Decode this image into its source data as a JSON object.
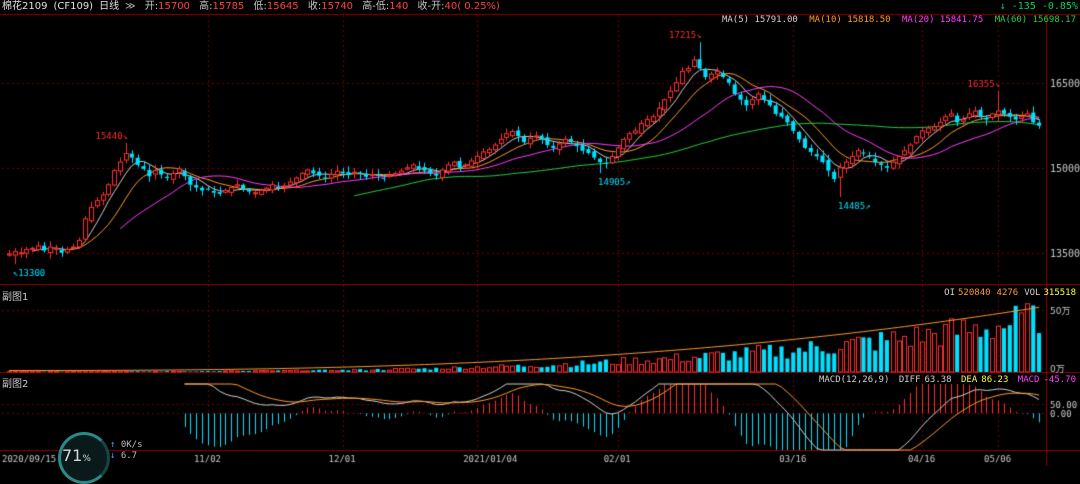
{
  "header": {
    "symbol": "棉花2109",
    "code": "(CF109)",
    "period": "日线",
    "open_label": "开:",
    "open": "15700",
    "high_label": "高:",
    "high": "15785",
    "low_label": "低:",
    "low": "15645",
    "close_label": "收:",
    "close": "15740",
    "hl_label": "高-低:",
    "hl": "140",
    "co_label": "收-开:",
    "co": "40( 0.25%)",
    "change": "↓ -135 -0.85%"
  },
  "ma_legend": [
    {
      "label": "MA(5)",
      "value": "15791.00",
      "color": "#d0d0d0"
    },
    {
      "label": "MA(10)",
      "value": "15818.50",
      "color": "#ff9a2a"
    },
    {
      "label": "MA(20)",
      "value": "15841.75",
      "color": "#ff3cff"
    },
    {
      "label": "MA(60)",
      "value": "15698.17",
      "color": "#20d040"
    }
  ],
  "sub1": {
    "title": "副图1",
    "oi_label": "OI",
    "oi": "520840",
    "change": "4276",
    "vol_label": "VOL",
    "vol": "315518",
    "ticks": [
      "50万",
      "0万"
    ]
  },
  "sub2": {
    "title": "副图2",
    "macd_label": "MACD(12,26,9)",
    "diff_label": "DIFF",
    "diff": "63.38",
    "dea_label": "DEA",
    "dea": "86.23",
    "macd_val_label": "MACD",
    "macd_val": "-45.70",
    "ticks": [
      "50.00",
      "0.00"
    ]
  },
  "gauge": {
    "value": "71",
    "unit": "%",
    "net_down": "0",
    "net_unit": "K/s",
    "net_up": "6.7"
  },
  "colors": {
    "up": "#ff3030",
    "down": "#00e0ff",
    "bg": "#000000",
    "grid": "#8b0000"
  },
  "chart_data": {
    "type": "candlestick",
    "price_ylim": [
      12950,
      17500
    ],
    "price_ticks": [
      13500,
      15000,
      16500
    ],
    "x_labels": [
      {
        "i": 0,
        "label": "2020/09/15"
      },
      {
        "i": 34,
        "label": "11/02"
      },
      {
        "i": 57,
        "label": "12/01"
      },
      {
        "i": 80,
        "label": "2021/01/04"
      },
      {
        "i": 104,
        "label": "02/01"
      },
      {
        "i": 134,
        "label": "03/16"
      },
      {
        "i": 156,
        "label": "04/16"
      },
      {
        "i": 169,
        "label": "05/06"
      }
    ],
    "annotations": [
      {
        "i": 1,
        "price": 13300,
        "text": "13300",
        "side": "low"
      },
      {
        "i": 20,
        "price": 15440,
        "text": "15440",
        "side": "high"
      },
      {
        "i": 101,
        "price": 14905,
        "text": "14905",
        "side": "low"
      },
      {
        "i": 118,
        "price": 17215,
        "text": "17215",
        "side": "high"
      },
      {
        "i": 142,
        "price": 14485,
        "text": "14485",
        "side": "low"
      },
      {
        "i": 169,
        "price": 16355,
        "text": "16355",
        "side": "high"
      }
    ],
    "closes": [
      13480,
      13520,
      13500,
      13560,
      13580,
      13620,
      13540,
      13600,
      13580,
      13500,
      13560,
      13600,
      13720,
      14100,
      14300,
      14420,
      14520,
      14700,
      14950,
      15100,
      15250,
      15180,
      15050,
      14980,
      14850,
      14950,
      14880,
      14820,
      14900,
      14980,
      14850,
      14700,
      14650,
      14600,
      14620,
      14560,
      14540,
      14600,
      14650,
      14700,
      14620,
      14580,
      14560,
      14600,
      14640,
      14700,
      14650,
      14680,
      14750,
      14820,
      14900,
      14960,
      14900,
      14860,
      14820,
      14880,
      14940,
      14900,
      14870,
      14920,
      14890,
      14840,
      14880,
      14860,
      14820,
      14860,
      14900,
      14940,
      15000,
      15050,
      14980,
      14950,
      14900,
      14860,
      14960,
      15050,
      15100,
      15000,
      15050,
      15120,
      15200,
      15280,
      15320,
      15400,
      15500,
      15600,
      15640,
      15560,
      15450,
      15520,
      15560,
      15500,
      15400,
      15350,
      15420,
      15500,
      15450,
      15380,
      15300,
      15260,
      15180,
      15100,
      15080,
      15200,
      15350,
      15500,
      15600,
      15650,
      15780,
      15850,
      15900,
      16050,
      16200,
      16350,
      16500,
      16700,
      16750,
      16900,
      16750,
      16600,
      16650,
      16700,
      16600,
      16500,
      16300,
      16200,
      16100,
      16200,
      16300,
      16200,
      16100,
      15950,
      15900,
      15800,
      15650,
      15500,
      15350,
      15280,
      15200,
      15100,
      14950,
      14800,
      15000,
      15100,
      15200,
      15300,
      15250,
      15200,
      15100,
      15050,
      15000,
      15100,
      15200,
      15300,
      15400,
      15550,
      15650,
      15700,
      15720,
      15800,
      15900,
      15950,
      15800,
      15850,
      15950,
      16000,
      15900,
      15850,
      15950,
      16000,
      15950,
      15900,
      15850,
      15900,
      15950,
      15800,
      15740
    ],
    "volume_range": [
      0,
      600000
    ],
    "macd_range": [
      -200,
      160
    ]
  }
}
